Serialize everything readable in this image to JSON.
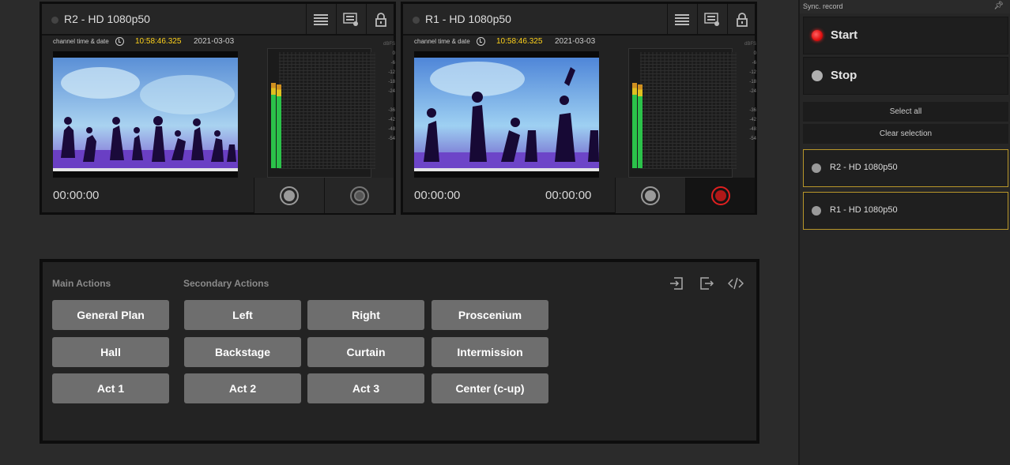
{
  "channels": [
    {
      "title": "R2 - HD 1080p50",
      "meta_label": "channel time & date",
      "time": "10:58:46.325",
      "date": "2021-03-03",
      "vu_unit": "dBFS",
      "vu_scale": [
        "0",
        "-6",
        "-12",
        "-18",
        "-24",
        "-36",
        "-42",
        "-48",
        "-54"
      ],
      "timecode_left": "00:00:00",
      "timecode_right": "",
      "recording": false
    },
    {
      "title": "R1 - HD 1080p50",
      "meta_label": "channel time & date",
      "time": "10:58:46.325",
      "date": "2021-03-03",
      "vu_unit": "dBFS",
      "vu_scale": [
        "0",
        "-6",
        "-12",
        "-18",
        "-24",
        "-36",
        "-42",
        "-48",
        "-54"
      ],
      "timecode_left": "00:00:00",
      "timecode_right": "00:00:00",
      "recording": true
    }
  ],
  "actions": {
    "main_label": "Main Actions",
    "secondary_label": "Secondary Actions",
    "main_buttons": [
      "General Plan",
      "Hall",
      "Act 1"
    ],
    "secondary_buttons": [
      [
        "Left",
        "Right",
        "Proscenium"
      ],
      [
        "Backstage",
        "Curtain",
        "Intermission"
      ],
      [
        "Act 2",
        "Act 3",
        "Center (c-up)"
      ]
    ],
    "icons": [
      "import-icon",
      "export-icon",
      "code-icon"
    ]
  },
  "sync": {
    "title": "Sync. record",
    "start_label": "Start",
    "stop_label": "Stop",
    "select_all_label": "Select all",
    "clear_selection_label": "Clear selection",
    "items": [
      "R2 - HD 1080p50",
      "R1 - HD 1080p50"
    ]
  },
  "colors": {
    "accent_yellow": "#ffd21a",
    "record_red": "#e02020",
    "selection_border": "#b8962a",
    "vu_green": "#2bc24a"
  }
}
